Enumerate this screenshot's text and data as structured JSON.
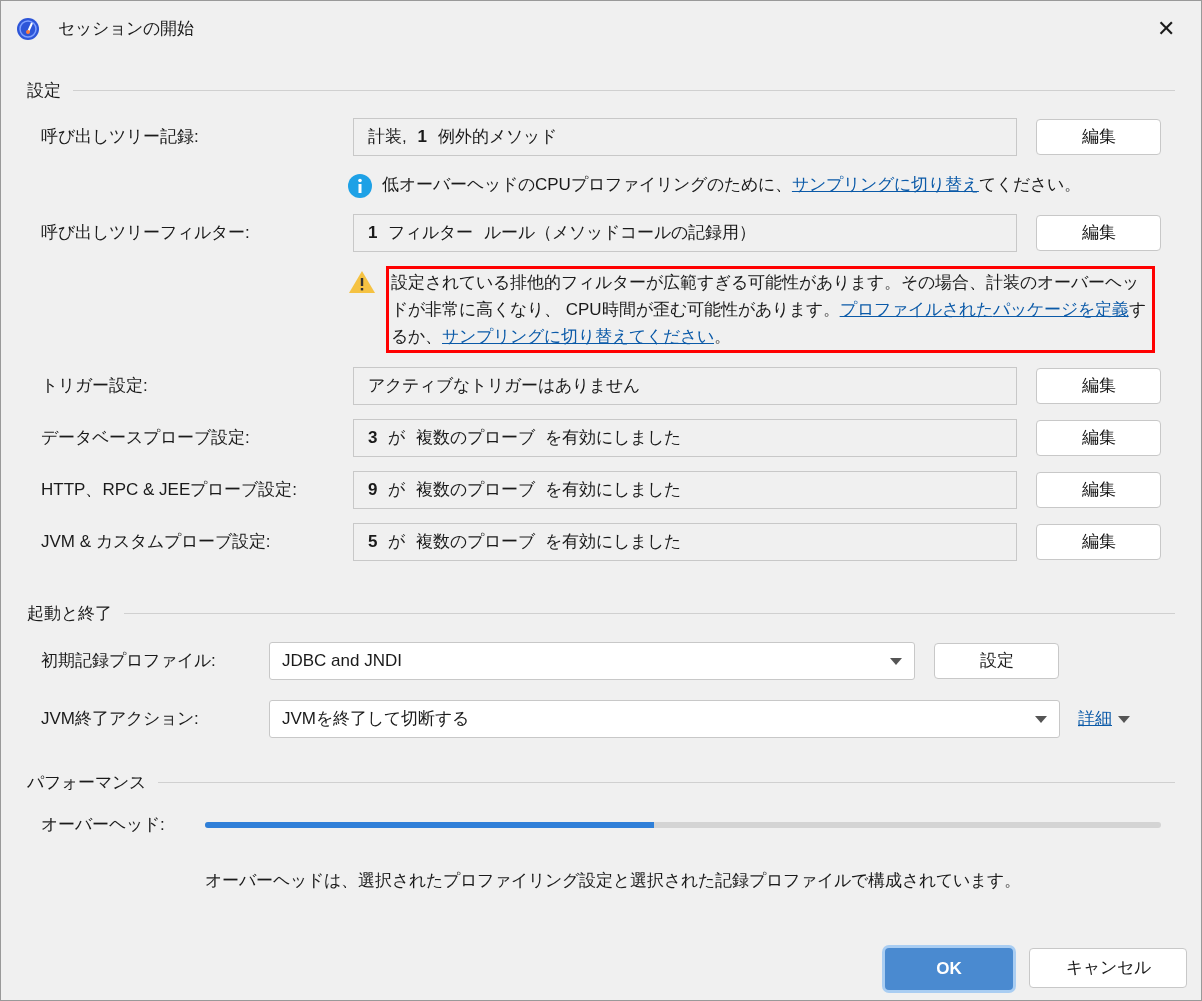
{
  "window": {
    "title": "セッションの開始",
    "close": "✕"
  },
  "sections": [
    {
      "title": "設定",
      "rows": [
        {
          "kind": "field",
          "label": "呼び出しツリー記録:",
          "value": "計装, **1** 例外的メソッド",
          "button": "編集"
        },
        {
          "kind": "info",
          "highlighted": false,
          "parts": [
            {
              "kind": "text",
              "text": "低オーバーヘッドのCPUプロファイリングのために、"
            },
            {
              "kind": "link",
              "text": "サンプリングに切り替え"
            },
            {
              "kind": "text",
              "text": "てください。"
            }
          ]
        },
        {
          "kind": "field",
          "label": "呼び出しツリーフィルター:",
          "value": "**1** フィルター ルール（メソッドコールの記録用）",
          "button": "編集"
        },
        {
          "kind": "warning",
          "highlighted": true,
          "parts": [
            {
              "kind": "text",
              "text": "設定されている排他的フィルターが広範すぎる可能性があります。その場合、計装のオーバーヘッドが非常に高くなり、 CPU時間が歪む可能性があります。"
            },
            {
              "kind": "link",
              "text": "プロファイルされた"
            },
            {
              "kind": "link",
              "text": "パッケージを定義"
            },
            {
              "kind": "text",
              "text": "するか、"
            },
            {
              "kind": "link",
              "text": "サンプリングに切り替えてください"
            },
            {
              "kind": "text",
              "text": "。"
            }
          ]
        },
        {
          "kind": "field",
          "label": "トリガー設定:",
          "value": "アクティブなトリガーはありません",
          "button": "編集"
        },
        {
          "kind": "field",
          "label": "データベースプローブ設定:",
          "value": "**3** が 複数のプローブ を有効にしました",
          "button": "編集"
        },
        {
          "kind": "field",
          "label": "HTTP、RPC & JEEプローブ設定:",
          "value": "**9** が 複数のプローブ を有効にしました",
          "button": "編集"
        },
        {
          "kind": "field",
          "label": "JVM & カスタムプローブ設定:",
          "value": "**5** が 複数のプローブ を有効にしました",
          "button": "編集"
        }
      ]
    },
    {
      "title": "起動と終了",
      "rows": [
        {
          "kind": "dropdown",
          "label": "初期記録プロファイル:",
          "value": "JDBC and JNDI",
          "button": "設定"
        },
        {
          "kind": "dropdown",
          "label": "JVM終了アクション:",
          "value": "JVMを終了して切断する",
          "link": "詳細"
        }
      ]
    },
    {
      "title": "パフォーマンス",
      "rows": [
        {
          "kind": "meter",
          "label": "オーバーヘッド:",
          "level": 0.47
        },
        {
          "kind": "caption",
          "text": "オーバーヘッドは、選択されたプロファイリング設定と選択された記録プロファイルで構成されています。"
        }
      ]
    }
  ],
  "buttons": [
    {
      "label": "OK",
      "default": true
    },
    {
      "label": "キャンセル",
      "default": false
    }
  ]
}
